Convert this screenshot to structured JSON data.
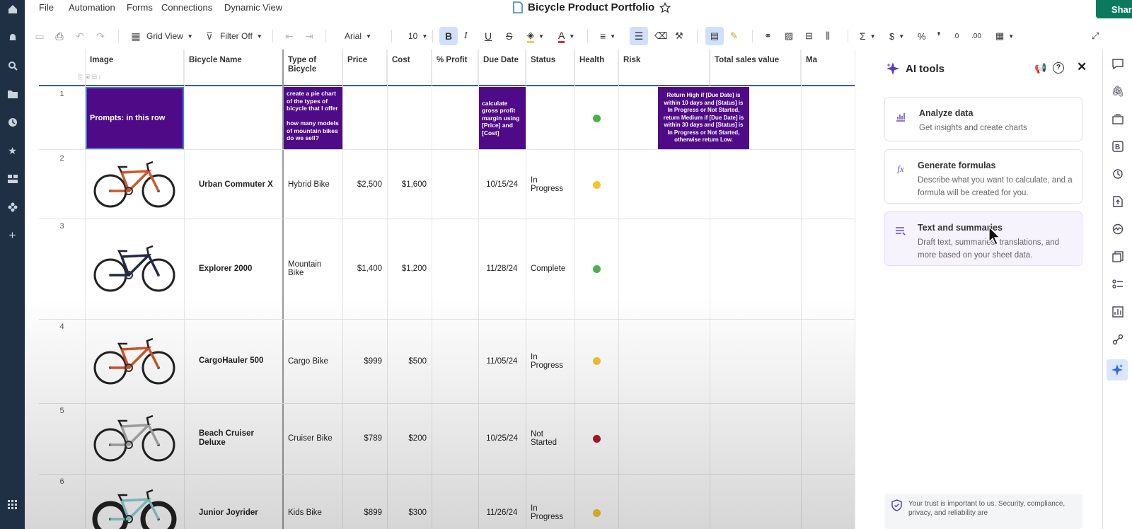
{
  "menu": {
    "file": "File",
    "automation": "Automation",
    "forms": "Forms",
    "connections": "Connections",
    "dynamic_view": "Dynamic View"
  },
  "title": "Bicycle Product Portfolio",
  "share_label": "Share",
  "toolbar": {
    "grid_view": "Grid View",
    "filter": "Filter Off",
    "font": "Arial",
    "font_size": "10"
  },
  "columns": {
    "image": "Image",
    "name": "Bicycle Name",
    "type": "Type of Bicycle",
    "price": "Price",
    "cost": "Cost",
    "profit": "% Profit",
    "due": "Due Date",
    "status": "Status",
    "health": "Health",
    "risk": "Risk",
    "total": "Total sales value",
    "extra": "Ma"
  },
  "rows": [
    {
      "num": "1",
      "image_prompt": "Prompts: in this row",
      "type_prompt": "create a pie chart of the types of bicycle that I offer\n\nhow many models of mountain bikes do we sell?",
      "profit_prompt": "calculate gross profit margin using [Price] and [Cost]",
      "risk_prompt": "Return High if [Due Date] is within 10 days and [Status] is In Progress or Not Started, return Medium if [Due Date] is within 30 days and [Status] is In Progress or Not Started, otherwise return Low.",
      "health": "#4caf50"
    },
    {
      "num": "2",
      "name": "Urban Commuter X",
      "type": "Hybrid Bike",
      "price": "$2,500",
      "cost": "$1,600",
      "due": "10/15/24",
      "status": "In Progress",
      "health": "#f2c530",
      "bike": "road"
    },
    {
      "num": "3",
      "name": "Explorer 2000",
      "type": "Mountain Bike",
      "price": "$1,400",
      "cost": "$1,200",
      "due": "11/28/24",
      "status": "Complete",
      "health": "#4caf50",
      "bike": "mtb"
    },
    {
      "num": "4",
      "name": "CargoHauler 500",
      "type": "Cargo Bike",
      "price": "$999",
      "cost": "$500",
      "due": "11/05/24",
      "status": "In Progress",
      "health": "#f2c530",
      "bike": "road"
    },
    {
      "num": "5",
      "name": "Beach Cruiser Deluxe",
      "type": "Cruiser Bike",
      "price": "$789",
      "cost": "$200",
      "due": "10/25/24",
      "status": "Not Started",
      "health": "#b0182a",
      "bike": "cruiser"
    },
    {
      "num": "6",
      "name": "Junior Joyrider",
      "type": "Kids Bike",
      "price": "$899",
      "cost": "$300",
      "due": "11/26/24",
      "status": "In Progress",
      "health": "#f2c530",
      "bike": "kids"
    }
  ],
  "ai_panel": {
    "title": "AI tools",
    "cards": [
      {
        "title": "Analyze data",
        "desc": "Get insights and create charts"
      },
      {
        "title": "Generate formulas",
        "desc": "Describe what you want to calculate, and a formula will be created for you."
      },
      {
        "title": "Text and summaries",
        "desc": "Draft text, summaries, translations, and more based on your sheet data."
      }
    ],
    "trust": "Your trust is important to us. Security, compliance, privacy, and reliability are"
  },
  "colors": {
    "accent": "#0b7a5c",
    "prompt_purple": "#4f0a87",
    "nav": "#1f3044"
  }
}
